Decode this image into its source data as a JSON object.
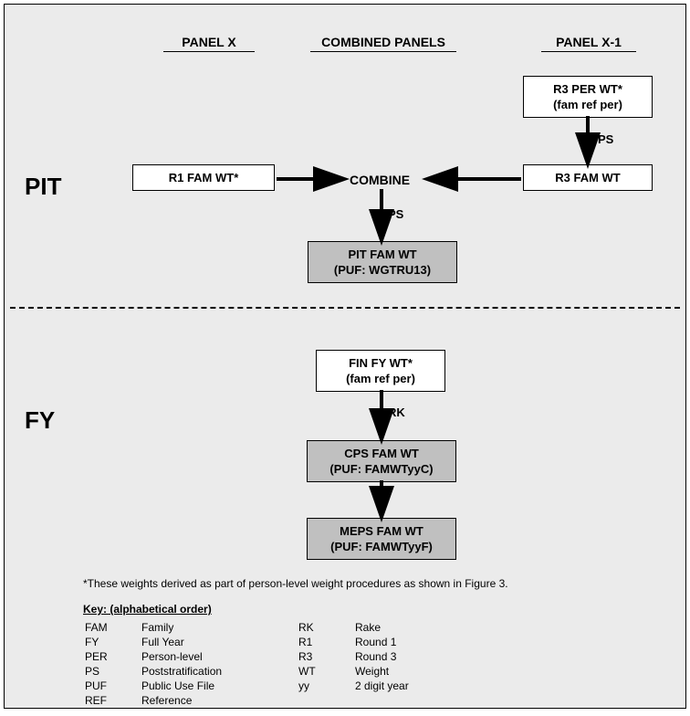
{
  "headers": {
    "panelX": "PANEL X",
    "combined": "COMBINED PANELS",
    "panelX1": "PANEL X-1"
  },
  "side": {
    "pit": "PIT",
    "fy": "FY"
  },
  "pit": {
    "r3per_l1": "R3 PER WT*",
    "r3per_l2": "(fam ref per)",
    "ps1": "PS",
    "r1fam": "R1 FAM WT*",
    "r3fam": "R3 FAM WT",
    "combine": "COMBINE",
    "ps2": "PS",
    "out_l1": "PIT FAM WT",
    "out_l2": "(PUF: WGTRU13)"
  },
  "fy": {
    "fin_l1": "FIN FY WT*",
    "fin_l2": "(fam ref per)",
    "rk": "RK",
    "cps_l1": "CPS FAM WT",
    "cps_l2": "(PUF: FAMWTyyC)",
    "meps_l1": "MEPS FAM WT",
    "meps_l2": "(PUF: FAMWTyyF)"
  },
  "note": "*These weights derived as part of person-level weight procedures as shown in Figure 3.",
  "keyHeader": "Key: (alphabetical order)",
  "key": {
    "c1": [
      {
        "a": "FAM",
        "d": "Family"
      },
      {
        "a": "FY",
        "d": "Full Year"
      },
      {
        "a": "PER",
        "d": "Person-level"
      },
      {
        "a": "PS",
        "d": "Poststratification"
      },
      {
        "a": "PUF",
        "d": "Public Use File"
      },
      {
        "a": "REF",
        "d": "Reference"
      }
    ],
    "c2": [
      {
        "a": "RK",
        "d": "Rake"
      },
      {
        "a": "R1",
        "d": "Round 1"
      },
      {
        "a": "R3",
        "d": "Round 3"
      },
      {
        "a": "WT",
        "d": "Weight"
      },
      {
        "a": "yy",
        "d": "2 digit year"
      }
    ]
  }
}
